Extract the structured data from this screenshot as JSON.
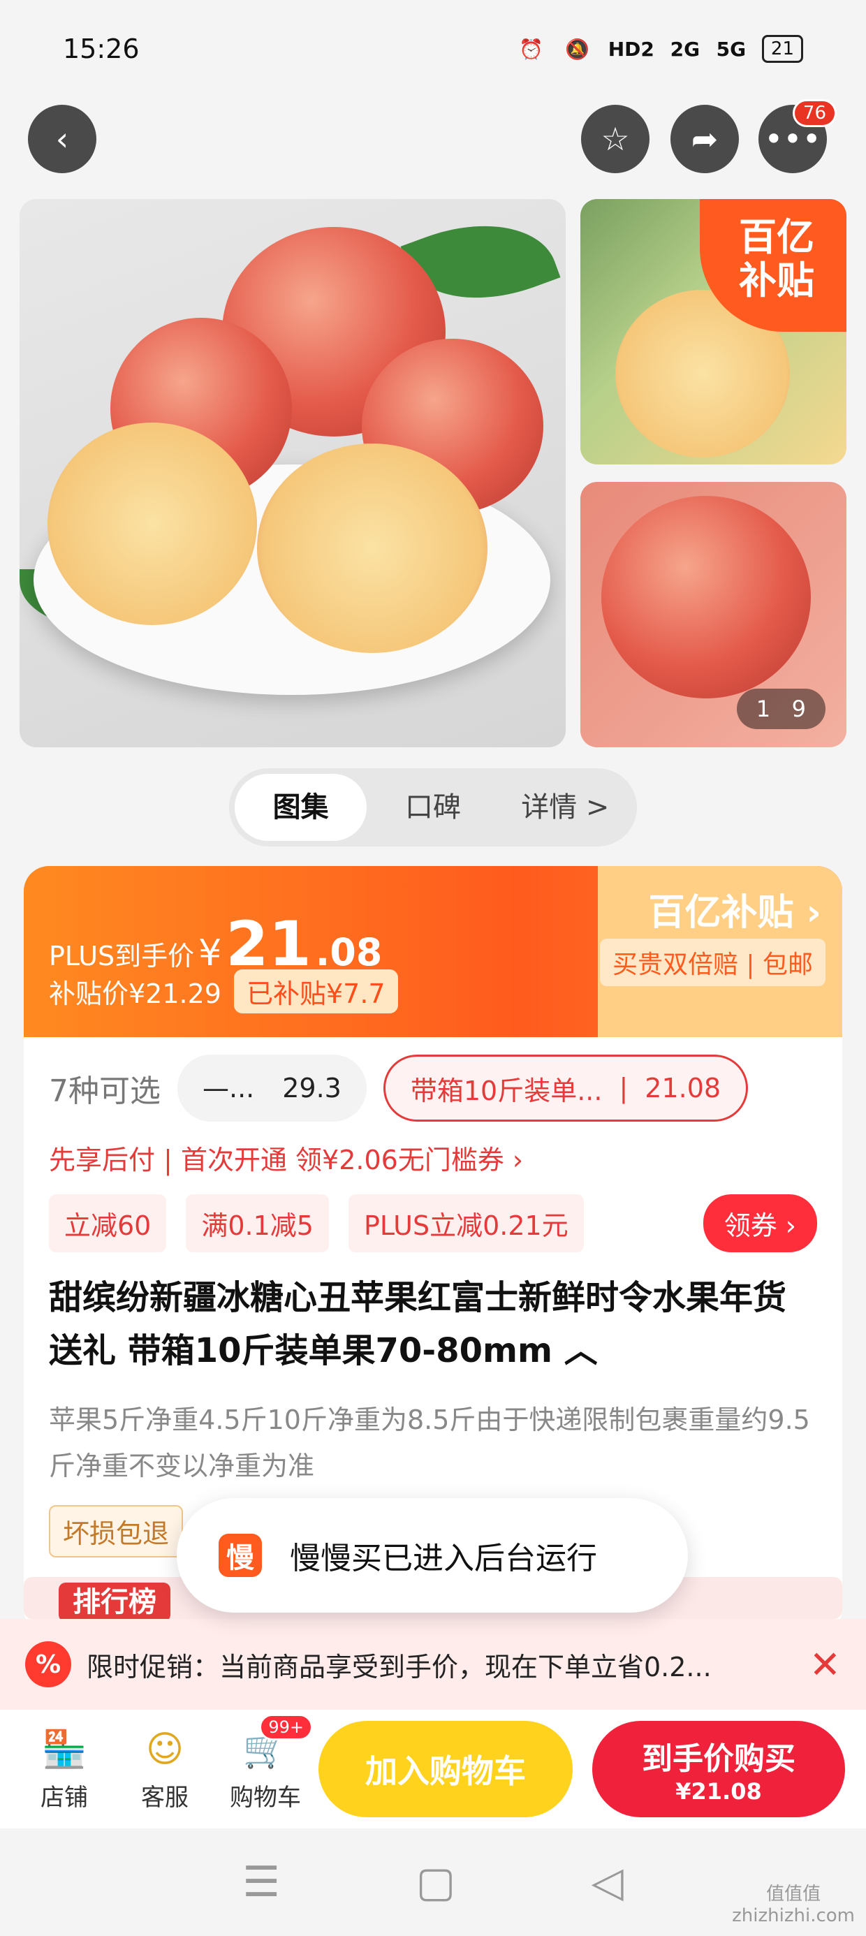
{
  "status": {
    "time": "15:26",
    "hd": "HD2",
    "net1": "2G",
    "net2": "5G",
    "battery": "21"
  },
  "topnav": {
    "more_badge": "76"
  },
  "gallery": {
    "badge_line1": "百亿",
    "badge_line2": "补贴",
    "counter_current": "1",
    "counter_total": "9"
  },
  "segment": {
    "tabs": [
      "图集",
      "口碑",
      "详情 >"
    ]
  },
  "price": {
    "plus_label": "PLUS到手价",
    "currency": "¥",
    "price_int": "21",
    "price_dec": ".08",
    "subsidy_price": "补贴价¥21.29",
    "subsidy_tag": "已补贴¥7.7",
    "brand_title": "百亿补贴 ›",
    "brand_tag": "买贵双倍赔 | 包邮"
  },
  "options": {
    "label": "7种可选",
    "grey_name": "—...",
    "grey_price": "29.3",
    "red_name": "带箱10斤装单...",
    "red_price": "21.08"
  },
  "paylater": "先享后付 | 首次开通 领¥2.06无门槛券 ›",
  "coupons": [
    "立减60",
    "满0.1减5",
    "PLUS立减0.21元"
  ],
  "get_coupon": "领券 ›",
  "title": "甜缤纷新疆冰糖心丑苹果红富士新鲜时令水果年货送礼 带箱10斤装单果70-80mm ︿",
  "description": "苹果5斤净重4.5斤10斤净重为8.5斤由于快递限制包裹重量约9.5斤净重不变以净重为准",
  "damage_tag": "坏损包退",
  "toast": {
    "icon": "慢",
    "text": "慢慢买已进入后台运行"
  },
  "rank": {
    "label": "排行榜"
  },
  "promo": {
    "icon": "%",
    "text": "限时促销：当前商品享受到手价，现在下单立省0.2...",
    "close": "✕"
  },
  "bottombar": {
    "shop": "店铺",
    "service": "客服",
    "cart": "购物车",
    "cart_badge": "99+",
    "add_cart": "加入购物车",
    "buy_line1": "到手价购买",
    "buy_line2": "¥21.08"
  },
  "watermark": "值值值\nzhizhizhi.com",
  "colors": {
    "accent": "#ff5b1e",
    "buy": "#f0213a",
    "cart": "#ffd21e"
  }
}
